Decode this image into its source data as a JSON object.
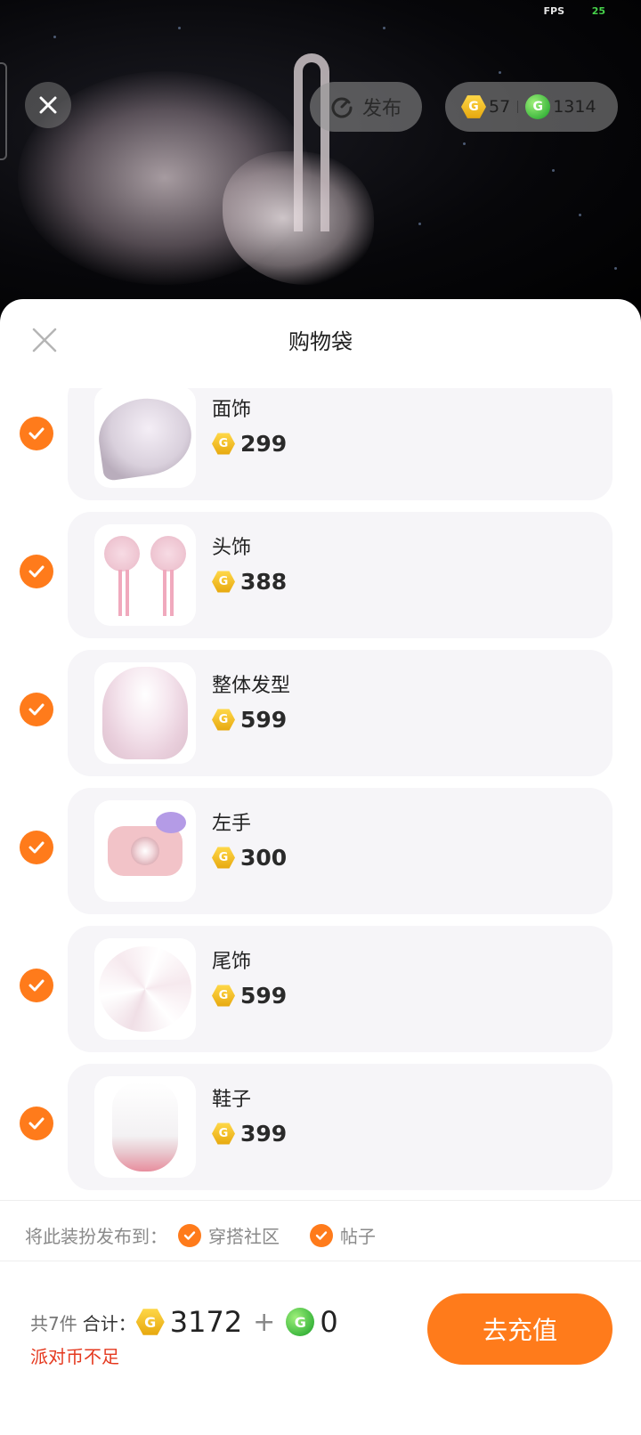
{
  "hud": {
    "fps_label": "FPS",
    "fps_value": "25"
  },
  "topbar": {
    "publish_label": "发布",
    "gold_balance": "57",
    "green_balance": "1314"
  },
  "sheet": {
    "title": "购物袋"
  },
  "items": [
    {
      "name": "面饰",
      "price": "299",
      "checked": true
    },
    {
      "name": "头饰",
      "price": "388",
      "checked": true
    },
    {
      "name": "整体发型",
      "price": "599",
      "checked": true
    },
    {
      "name": "左手",
      "price": "300",
      "checked": true
    },
    {
      "name": "尾饰",
      "price": "599",
      "checked": true
    },
    {
      "name": "鞋子",
      "price": "399",
      "checked": true
    }
  ],
  "publish_to": {
    "label": "将此装扮发布到：",
    "options": [
      {
        "label": "穿搭社区",
        "checked": true
      },
      {
        "label": "帖子",
        "checked": true
      }
    ]
  },
  "footer": {
    "count_label": "共7件",
    "total_label": "合计：",
    "gold_total": "3172",
    "plus": "+",
    "green_total": "0",
    "warning": "派对币不足",
    "recharge_label": "去充值"
  },
  "colors": {
    "accent": "#ff7b1b",
    "warning": "#e5391f",
    "gold": "#e9b11a",
    "green": "#3fb83f"
  }
}
